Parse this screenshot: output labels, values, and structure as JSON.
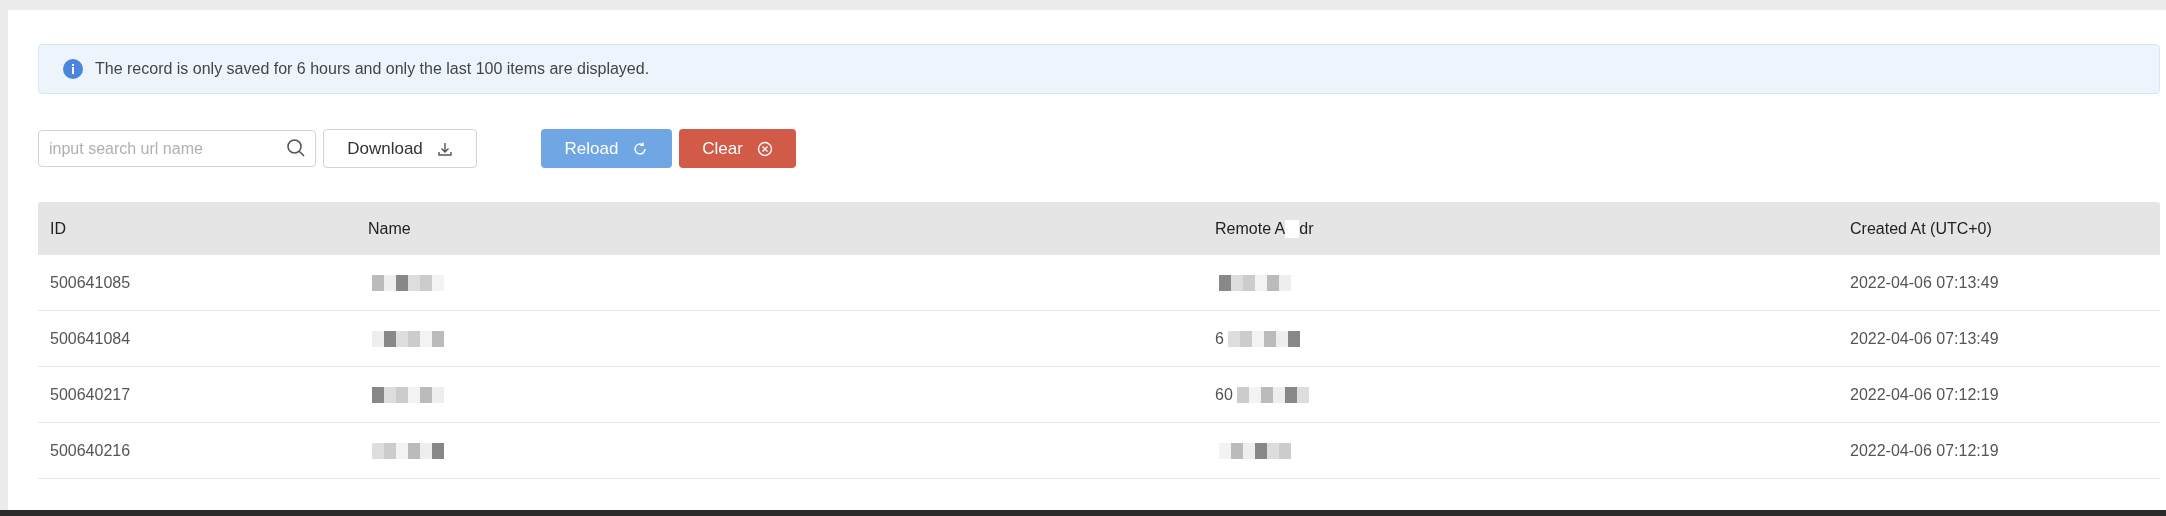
{
  "notice": {
    "text": "The record is only saved for 6 hours and only the last 100 items are displayed."
  },
  "toolbar": {
    "search": {
      "placeholder": "input search url name"
    },
    "buttons": [
      {
        "label": "Download",
        "kind": "download"
      },
      {
        "label": "Reload",
        "kind": "reload"
      },
      {
        "label": "Clear",
        "kind": "clear"
      }
    ]
  },
  "table": {
    "columns": [
      {
        "label": "ID"
      },
      {
        "label": "Name"
      },
      {
        "label": "Remote A",
        "label_tail": "dr"
      },
      {
        "label": "Created At (UTC+0)"
      }
    ],
    "rows": [
      {
        "id": "500641085",
        "remote_addr_prefix": "",
        "created_at": "2022-04-06 07:13:49"
      },
      {
        "id": "500641084",
        "remote_addr_prefix": "6",
        "created_at": "2022-04-06 07:13:49"
      },
      {
        "id": "500640217",
        "remote_addr_prefix": "60",
        "created_at": "2022-04-06 07:12:19"
      },
      {
        "id": "500640216",
        "remote_addr_prefix": "",
        "created_at": "2022-04-06 07:12:19"
      }
    ]
  }
}
